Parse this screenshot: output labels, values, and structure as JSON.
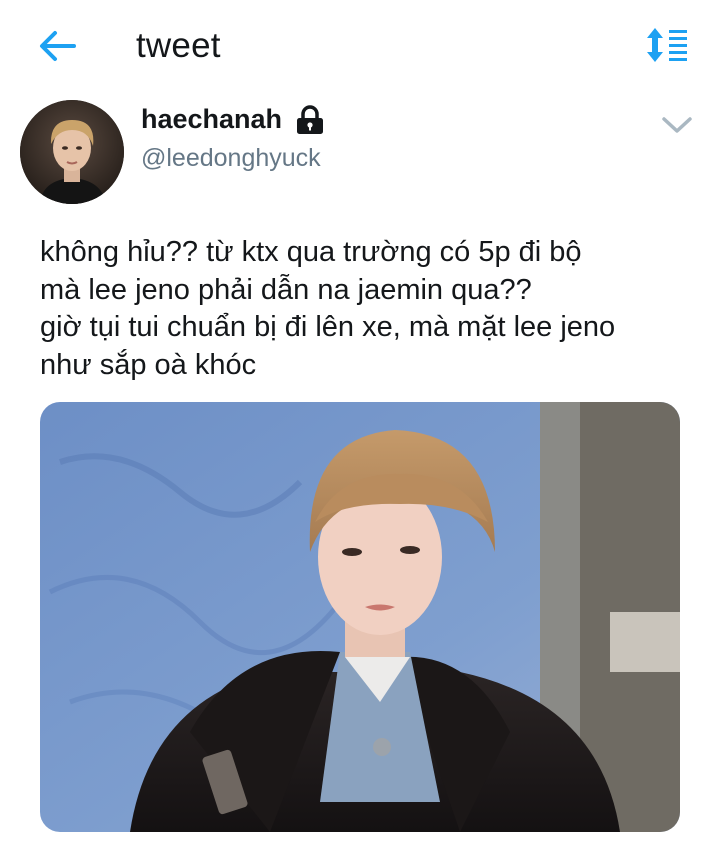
{
  "header": {
    "title": "tweet",
    "back_icon": "arrow-left-icon",
    "sort_icon": "sort-icon",
    "accent_color": "#1da1f2"
  },
  "author": {
    "display_name": "haechanah",
    "handle": "@leedonghyuck",
    "protected_icon": "lock-icon",
    "avatar_icon": "avatar-photo",
    "menu_icon": "chevron-down-icon"
  },
  "tweet": {
    "lines": [
      "không hỉu?? từ ktx qua trường có 5p đi bộ",
      "mà lee jeno phải dẫn na jaemin qua??",
      "giờ tụi tui chuẩn bị đi lên xe, mà mặt lee jeno",
      "như sắp oà khóc"
    ]
  },
  "media": {
    "type": "photo"
  }
}
